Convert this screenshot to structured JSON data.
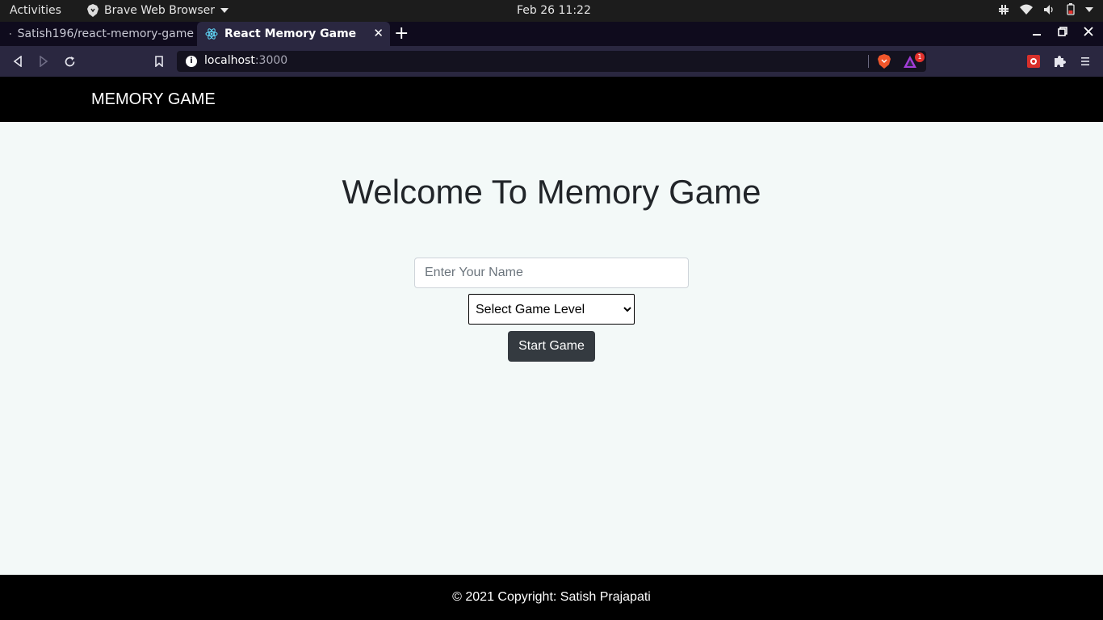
{
  "system_bar": {
    "activities": "Activities",
    "app_name": "Brave Web Browser",
    "clock": "Feb 26  11:22"
  },
  "tabs": [
    {
      "label": "Satish196/react-memory-game",
      "icon": "github-icon",
      "active": false
    },
    {
      "label": "React Memory Game",
      "icon": "react-icon",
      "active": true
    }
  ],
  "toolbar": {
    "url_host": "localhost",
    "url_port": ":3000",
    "notification_count": "1"
  },
  "navbar": {
    "brand": "MEMORY GAME"
  },
  "main": {
    "title": "Welcome To Memory Game",
    "name_placeholder": "Enter Your Name",
    "name_value": "",
    "level_selected": "Select Game Level",
    "start_button": "Start Game"
  },
  "footer": {
    "copyright": "© 2021 Copyright: Satish Prajapati"
  },
  "colors": {
    "page_bg": "#f3f9f8",
    "navbar_bg": "#000000",
    "button_bg": "#343a40",
    "browser_chrome": "#2a2740"
  }
}
